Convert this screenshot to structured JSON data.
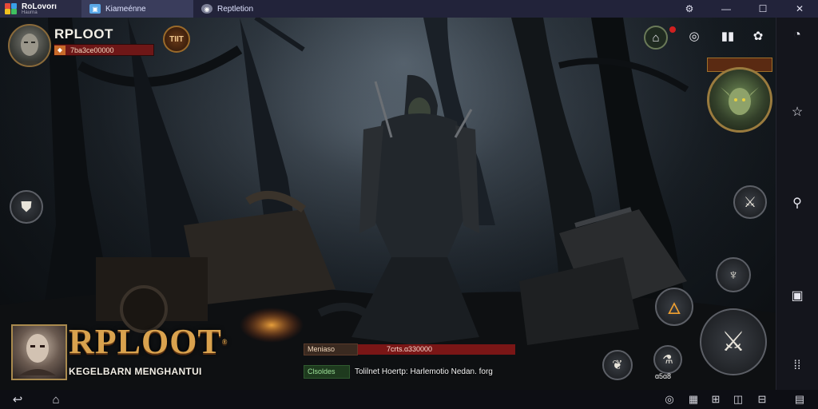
{
  "window": {
    "brand_name": "RoLovorı",
    "brand_sub": "Haurna",
    "tabs": [
      {
        "label": "Kiameénne",
        "icon": "app-icon",
        "active": true
      },
      {
        "label": "Reptletion",
        "icon": "game-icon",
        "active": false
      }
    ],
    "controls": {
      "settings": "⚙",
      "minimize": "—",
      "maximize": "☐",
      "close": "✕"
    }
  },
  "player": {
    "name": "RPLOOT",
    "currency": "7ba3ce00000",
    "level_badge": "TIIT"
  },
  "top_icons": [
    "guild-icon",
    "camera-icon",
    "bag-icon",
    "settings-icon"
  ],
  "side_icons": [
    "history-icon",
    "star-icon",
    "search-icon",
    "screenshot-icon",
    "more-icon"
  ],
  "skills": [
    "sword-skill-icon",
    "lamp-skill-icon",
    "fire-skill-icon",
    "attack-icon",
    "feather-skill-icon",
    "potion-skill-icon",
    "shield-icon"
  ],
  "skill_labels": {
    "potion": "ɑ5ɑ8"
  },
  "game": {
    "title": "RPLOOT",
    "registered": "®",
    "tagline": "KEGELBARN MENGHANTUI"
  },
  "info": {
    "label": "Meniaso",
    "value": "7crts.ɑ330000"
  },
  "chat": {
    "label": "Clsoldes",
    "text": "Tolilnet Hoertp: Harlemotio Nedan. forg"
  },
  "colors": {
    "accent_gold": "#d9a24e",
    "bar_red": "#7a1616",
    "chat_green": "#9ee29a"
  }
}
